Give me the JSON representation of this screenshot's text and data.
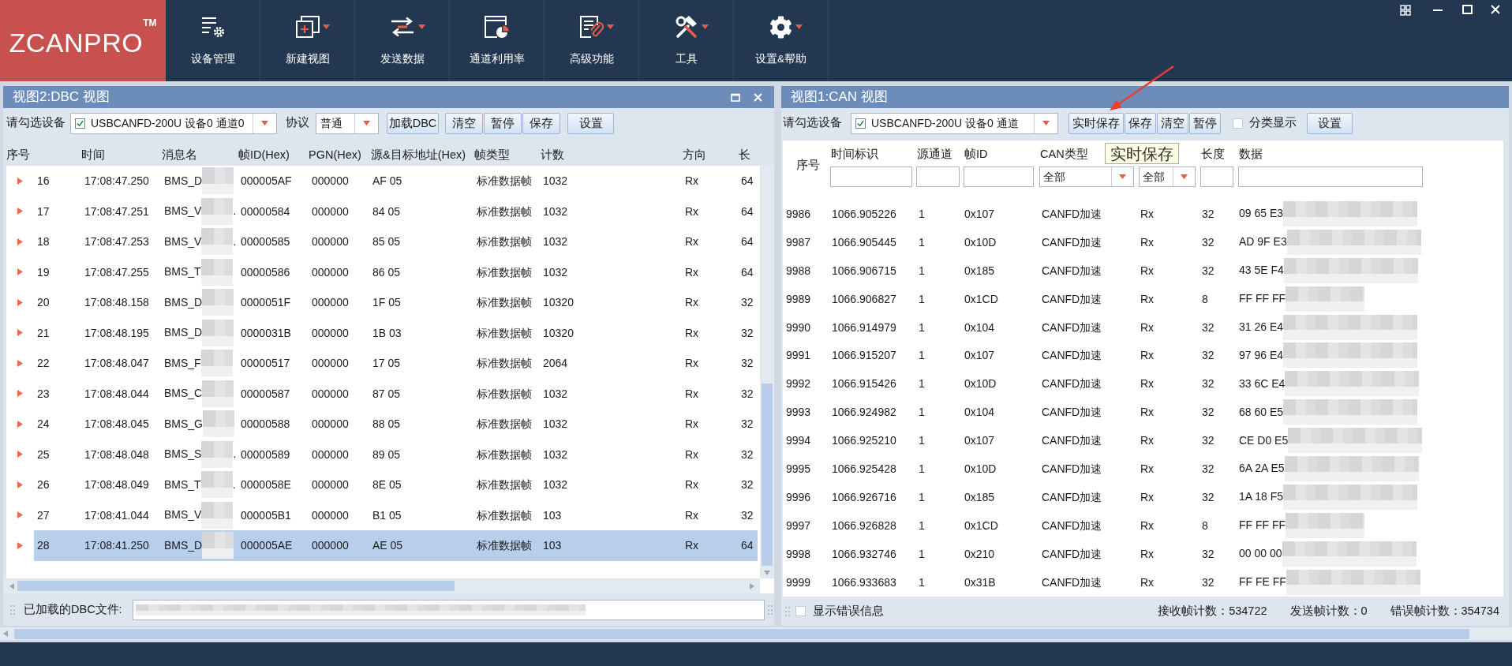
{
  "logo": {
    "text": "ZCANPRO",
    "mark": "TM"
  },
  "toolbar": [
    {
      "label": "设备管理",
      "has_menu": false
    },
    {
      "label": "新建视图",
      "has_menu": true
    },
    {
      "label": "发送数据",
      "has_menu": true
    },
    {
      "label": "通道利用率",
      "has_menu": false
    },
    {
      "label": "高级功能",
      "has_menu": true
    },
    {
      "label": "工具",
      "has_menu": true
    },
    {
      "label": "设置&帮助",
      "has_menu": true
    }
  ],
  "dbc_view": {
    "title": "视图2:DBC 视图",
    "device_label": "请勾选设备",
    "device": {
      "checked": true,
      "value": "USBCANFD-200U 设备0 通道0"
    },
    "protocol_label": "协议",
    "protocol": "普通",
    "load_button": "加载DBC",
    "buttons": [
      "清空",
      "暂停",
      "保存"
    ],
    "settings_button": "设置",
    "columns": [
      "序号",
      "时间",
      "消息名",
      "帧ID(Hex)",
      "PGN(Hex)",
      "源&目标地址(Hex)",
      "帧类型",
      "计数",
      "方向",
      "长"
    ],
    "rows": [
      {
        "selected": false,
        "cells": [
          "16",
          "17:08:47.250",
          "BMS_D",
          "000005AF",
          "000000",
          "AF 05",
          "标准数据帧",
          "1032",
          "Rx",
          "64"
        ]
      },
      {
        "selected": false,
        "cells": [
          "17",
          "17:08:47.251",
          "BMS_V",
          "00000584",
          "000000",
          "84 05",
          "标准数据帧",
          "1032",
          "Rx",
          "64"
        ],
        "name_end": "."
      },
      {
        "selected": false,
        "cells": [
          "18",
          "17:08:47.253",
          "BMS_V",
          "00000585",
          "000000",
          "85 05",
          "标准数据帧",
          "1032",
          "Rx",
          "64"
        ],
        "name_end": "."
      },
      {
        "selected": false,
        "cells": [
          "19",
          "17:08:47.255",
          "BMS_T",
          "00000586",
          "000000",
          "86 05",
          "标准数据帧",
          "1032",
          "Rx",
          "64"
        ]
      },
      {
        "selected": false,
        "cells": [
          "20",
          "17:08:48.158",
          "BMS_D",
          "0000051F",
          "000000",
          "1F 05",
          "标准数据帧",
          "10320",
          "Rx",
          "32"
        ]
      },
      {
        "selected": false,
        "cells": [
          "21",
          "17:08:48.195",
          "BMS_D",
          "0000031B",
          "000000",
          "1B 03",
          "标准数据帧",
          "10320",
          "Rx",
          "32"
        ]
      },
      {
        "selected": false,
        "cells": [
          "22",
          "17:08:48.047",
          "BMS_F",
          "00000517",
          "000000",
          "17 05",
          "标准数据帧",
          "2064",
          "Rx",
          "32"
        ]
      },
      {
        "selected": false,
        "cells": [
          "23",
          "17:08:48.044",
          "BMS_C",
          "00000587",
          "000000",
          "87 05",
          "标准数据帧",
          "1032",
          "Rx",
          "32"
        ]
      },
      {
        "selected": false,
        "cells": [
          "24",
          "17:08:48.045",
          "BMS_G",
          "00000588",
          "000000",
          "88 05",
          "标准数据帧",
          "1032",
          "Rx",
          "32"
        ]
      },
      {
        "selected": false,
        "cells": [
          "25",
          "17:08:48.048",
          "BMS_S",
          "00000589",
          "000000",
          "89 05",
          "标准数据帧",
          "1032",
          "Rx",
          "32"
        ],
        "name_end": "."
      },
      {
        "selected": false,
        "cells": [
          "26",
          "17:08:48.049",
          "BMS_T",
          "0000058E",
          "000000",
          "8E 05",
          "标准数据帧",
          "1032",
          "Rx",
          "32"
        ],
        "name_end": "."
      },
      {
        "selected": false,
        "cells": [
          "27",
          "17:08:41.044",
          "BMS_V",
          "000005B1",
          "000000",
          "B1 05",
          "标准数据帧",
          "103",
          "Rx",
          "32"
        ]
      },
      {
        "selected": true,
        "cells": [
          "28",
          "17:08:41.250",
          "BMS_D",
          "000005AE",
          "000000",
          "AE 05",
          "标准数据帧",
          "103",
          "Rx",
          "64"
        ]
      }
    ],
    "file_label": "已加载的DBC文件:"
  },
  "can_view": {
    "title": "视图1:CAN 视图",
    "device_label": "请勾选设备",
    "device": {
      "checked": true,
      "value": "USBCANFD-200U 设备0 通道"
    },
    "buttons": [
      "实时保存",
      "保存",
      "清空",
      "暂停"
    ],
    "group_display": {
      "label": "分类显示",
      "checked": false
    },
    "settings_button": "设置",
    "tooltip": "实时保存",
    "columns": [
      {
        "kind": "plain",
        "label": "序号"
      },
      {
        "kind": "input",
        "label": "时间标识"
      },
      {
        "kind": "input",
        "label": "源通道"
      },
      {
        "kind": "input",
        "label": "帧ID"
      },
      {
        "kind": "dropdown",
        "label": "CAN类型",
        "value": "全部"
      },
      {
        "kind": "dropdown",
        "value": "全部"
      },
      {
        "kind": "input",
        "label": "长度"
      },
      {
        "kind": "input",
        "label": "数据"
      }
    ],
    "rows": [
      {
        "cells": [
          "9986",
          "1066.905226",
          "1",
          "0x107",
          "CANFD加速",
          "Rx",
          "32",
          "09 65 E3"
        ]
      },
      {
        "cells": [
          "9987",
          "1066.905445",
          "1",
          "0x10D",
          "CANFD加速",
          "Rx",
          "32",
          "AD 9F E3"
        ]
      },
      {
        "cells": [
          "9988",
          "1066.906715",
          "1",
          "0x185",
          "CANFD加速",
          "Rx",
          "32",
          "43 5E F4"
        ]
      },
      {
        "cells": [
          "9989",
          "1066.906827",
          "1",
          "0x1CD",
          "CANFD加速",
          "Rx",
          "8",
          "FF FF FF"
        ]
      },
      {
        "cells": [
          "9990",
          "1066.914979",
          "1",
          "0x104",
          "CANFD加速",
          "Rx",
          "32",
          "31 26 E4"
        ]
      },
      {
        "cells": [
          "9991",
          "1066.915207",
          "1",
          "0x107",
          "CANFD加速",
          "Rx",
          "32",
          "97 96 E4"
        ]
      },
      {
        "cells": [
          "9992",
          "1066.915426",
          "1",
          "0x10D",
          "CANFD加速",
          "Rx",
          "32",
          "33 6C E4"
        ]
      },
      {
        "cells": [
          "9993",
          "1066.924982",
          "1",
          "0x104",
          "CANFD加速",
          "Rx",
          "32",
          "68 60 E5"
        ]
      },
      {
        "cells": [
          "9994",
          "1066.925210",
          "1",
          "0x107",
          "CANFD加速",
          "Rx",
          "32",
          "CE D0 E5"
        ]
      },
      {
        "cells": [
          "9995",
          "1066.925428",
          "1",
          "0x10D",
          "CANFD加速",
          "Rx",
          "32",
          "6A 2A E5"
        ]
      },
      {
        "cells": [
          "9996",
          "1066.926716",
          "1",
          "0x185",
          "CANFD加速",
          "Rx",
          "32",
          "1A 18 F5"
        ]
      },
      {
        "cells": [
          "9997",
          "1066.926828",
          "1",
          "0x1CD",
          "CANFD加速",
          "Rx",
          "8",
          "FF FF FF"
        ]
      },
      {
        "cells": [
          "9998",
          "1066.932746",
          "1",
          "0x210",
          "CANFD加速",
          "Rx",
          "32",
          "00 00 00"
        ]
      },
      {
        "cells": [
          "9999",
          "1066.933683",
          "1",
          "0x31B",
          "CANFD加速",
          "Rx",
          "32",
          "FF FE FF"
        ]
      }
    ],
    "show_errors": {
      "label": "显示错误信息",
      "checked": false
    },
    "counters": [
      "接收帧计数：534722",
      "发送帧计数：0",
      "错误帧计数：354734"
    ]
  }
}
